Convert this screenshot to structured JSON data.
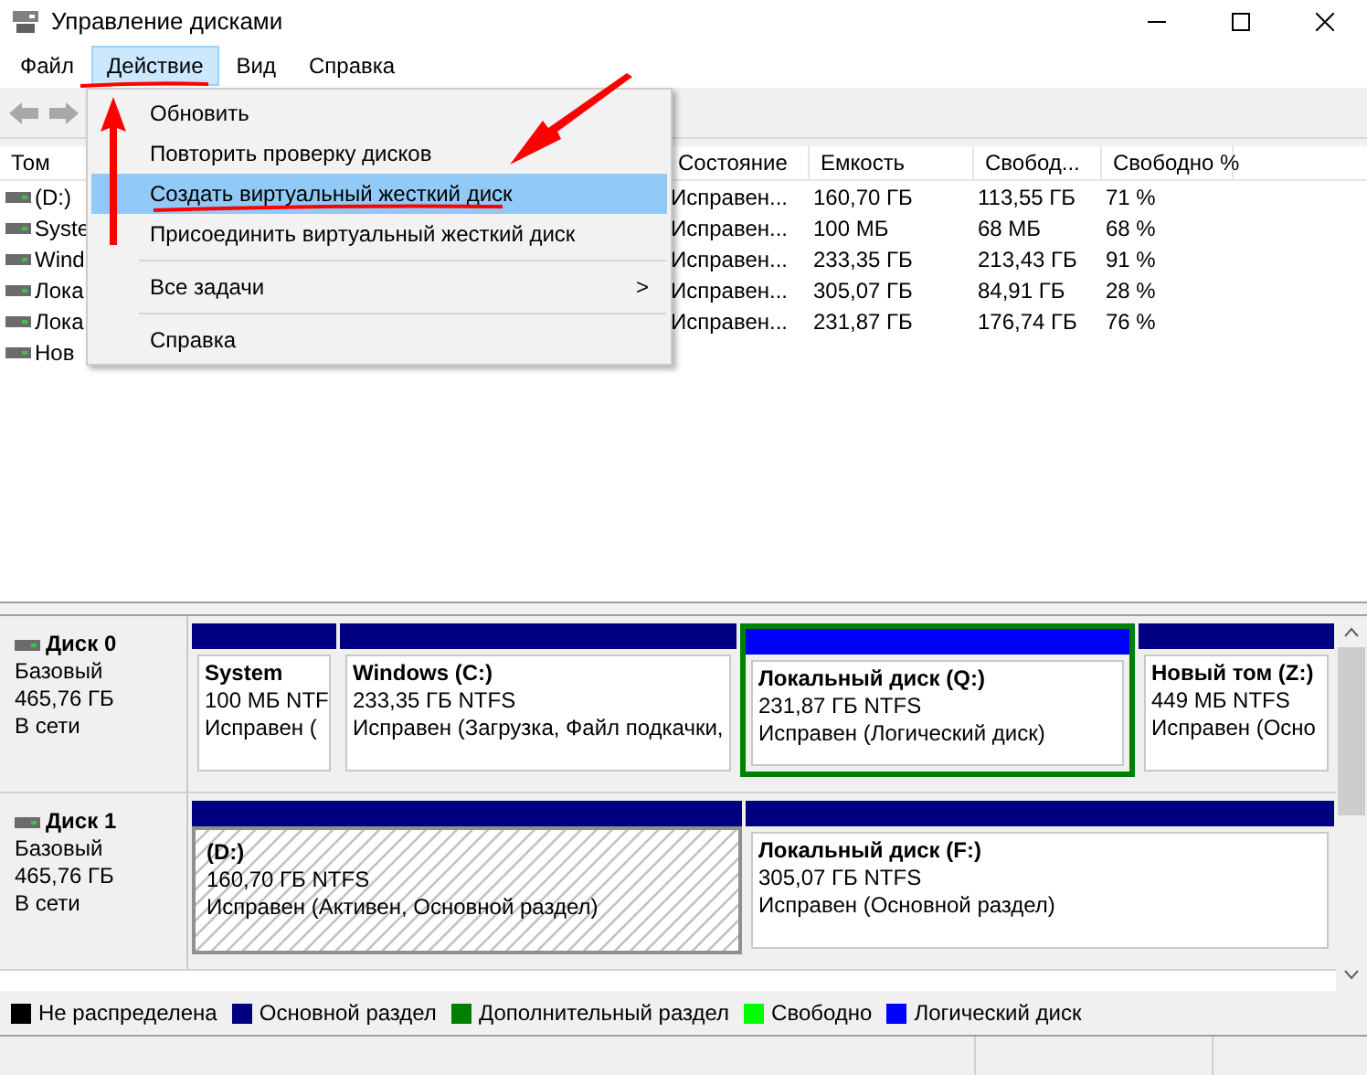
{
  "window": {
    "title": "Управление дисками"
  },
  "menubar": [
    {
      "label": "Файл",
      "selected": false
    },
    {
      "label": "Действие",
      "selected": true
    },
    {
      "label": "Вид",
      "selected": false
    },
    {
      "label": "Справка",
      "selected": false
    }
  ],
  "menu": [
    {
      "kind": "item",
      "label": "Обновить",
      "selected": false
    },
    {
      "kind": "item",
      "label": "Повторить проверку дисков",
      "selected": false
    },
    {
      "kind": "item",
      "label": "Создать виртуальный жесткий диск",
      "selected": true
    },
    {
      "kind": "item",
      "label": "Присоединить виртуальный жесткий диск",
      "selected": false
    },
    {
      "kind": "separator"
    },
    {
      "kind": "submenu",
      "label": "Все задачи",
      "arrow": ">",
      "selected": false
    },
    {
      "kind": "separator"
    },
    {
      "kind": "item",
      "label": "Справка",
      "selected": false
    }
  ],
  "table": {
    "columns": [
      "Том",
      "Состояние",
      "Емкость",
      "Свобод...",
      "Свободно %"
    ],
    "rows": [
      {
        "volume": "(D:)",
        "state": "Исправен...",
        "capacity": "160,70 ГБ",
        "free": "113,55 ГБ",
        "free_pct": "71 %"
      },
      {
        "volume": "Syste",
        "state": "Исправен...",
        "capacity": "100 МБ",
        "free": "68 МБ",
        "free_pct": "68 %"
      },
      {
        "volume": "Wind",
        "state": "Исправен...",
        "capacity": "233,35 ГБ",
        "free": "213,43 ГБ",
        "free_pct": "91 %"
      },
      {
        "volume": "Лока",
        "state": "Исправен...",
        "capacity": "305,07 ГБ",
        "free": "84,91 ГБ",
        "free_pct": "28 %"
      },
      {
        "volume": "Лока",
        "state": "Исправен...",
        "capacity": "231,87 ГБ",
        "free": "176,74 ГБ",
        "free_pct": "76 %"
      },
      {
        "volume": "Нов"
      }
    ]
  },
  "disks": [
    {
      "name": "Диск 0",
      "type": "Базовый",
      "size": "465,76 ГБ",
      "status": "В сети",
      "partitions": [
        {
          "kind": "primary",
          "extended": false,
          "selected": false,
          "name": "System",
          "size": "100 МБ NTF",
          "status": "Исправен ("
        },
        {
          "kind": "primary",
          "extended": false,
          "selected": false,
          "name": "Windows  (C:)",
          "size": "233,35 ГБ NTFS",
          "status": "Исправен (Загрузка, Файл подкачки,"
        },
        {
          "kind": "logical",
          "extended": true,
          "selected": false,
          "name": "Локальный диск  (Q:)",
          "size": "231,87 ГБ NTFS",
          "status": "Исправен (Логический диск)"
        },
        {
          "kind": "primary",
          "extended": false,
          "selected": false,
          "name": "Новый том  (Z:)",
          "size": "449 МБ NTFS",
          "status": "Исправен (Осно"
        }
      ]
    },
    {
      "name": "Диск 1",
      "type": "Базовый",
      "size": "465,76 ГБ",
      "status": "В сети",
      "partitions": [
        {
          "kind": "primary",
          "extended": false,
          "selected": true,
          "name": "(D:)",
          "size": "160,70 ГБ NTFS",
          "status": "Исправен (Активен, Основной раздел)"
        },
        {
          "kind": "primary",
          "extended": false,
          "selected": false,
          "name": "Локальный диск  (F:)",
          "size": "305,07 ГБ NTFS",
          "status": "Исправен (Основной раздел)"
        }
      ]
    }
  ],
  "legend": [
    {
      "label": "Не распределена",
      "color": "#000000"
    },
    {
      "label": "Основной раздел",
      "color": "#000080"
    },
    {
      "label": "Дополнительный раздел",
      "color": "#008000"
    },
    {
      "label": "Свободно",
      "color": "#00ff00"
    },
    {
      "label": "Логический диск",
      "color": "#0000ff"
    }
  ]
}
